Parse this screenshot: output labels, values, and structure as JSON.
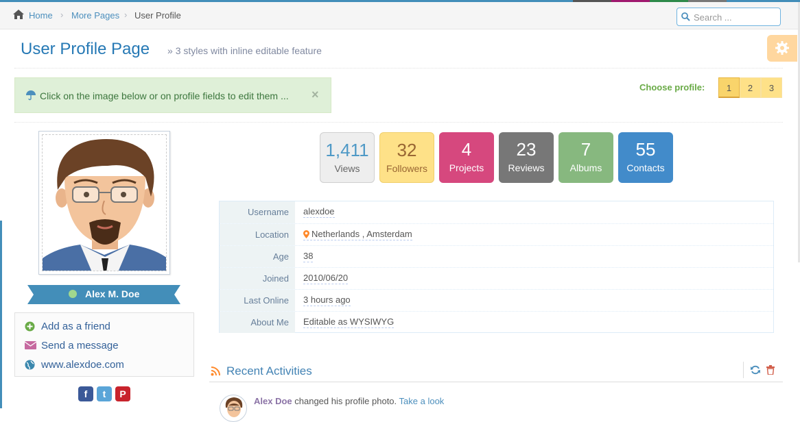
{
  "breadcrumbs": {
    "items": [
      {
        "label": "Home"
      },
      {
        "label": "More Pages"
      },
      {
        "label": "User Profile"
      }
    ]
  },
  "search": {
    "placeholder": "Search ..."
  },
  "header": {
    "title": "User Profile Page",
    "subtitle": "3 styles with inline editable feature"
  },
  "alert": {
    "text": "Click on the image below or on profile fields to edit them ...",
    "close": "×"
  },
  "profile_chooser": {
    "label": "Choose profile:",
    "options": [
      "1",
      "2",
      "3"
    ],
    "selected": "1"
  },
  "user": {
    "name": "Alex M. Doe",
    "status": "online"
  },
  "links": {
    "add_friend": "Add as a friend",
    "send_message": "Send a message",
    "website": "www.alexdoe.com"
  },
  "social": {
    "facebook": "f",
    "twitter": "t",
    "pinterest": "P"
  },
  "stats": [
    {
      "value": "1,411",
      "label": "Views",
      "color": "#eeeeee"
    },
    {
      "value": "32",
      "label": "Followers",
      "color": "#fee188"
    },
    {
      "value": "4",
      "label": "Projects",
      "color": "#d6487e"
    },
    {
      "value": "23",
      "label": "Reviews",
      "color": "#777777"
    },
    {
      "value": "7",
      "label": "Albums",
      "color": "#87b87f"
    },
    {
      "value": "55",
      "label": "Contacts",
      "color": "#428bca"
    }
  ],
  "info": [
    {
      "name": "Username",
      "value": "alexdoe"
    },
    {
      "name": "Location",
      "value": "Netherlands , Amsterdam"
    },
    {
      "name": "Age",
      "value": "38"
    },
    {
      "name": "Joined",
      "value": "2010/06/20"
    },
    {
      "name": "Last Online",
      "value": "3 hours ago"
    },
    {
      "name": "About Me",
      "value": "Editable as WYSIWYG"
    }
  ],
  "activities": {
    "title": "Recent Activities",
    "items": [
      {
        "user": "Alex Doe",
        "action": "changed his profile photo.",
        "link": "Take a look"
      }
    ]
  }
}
